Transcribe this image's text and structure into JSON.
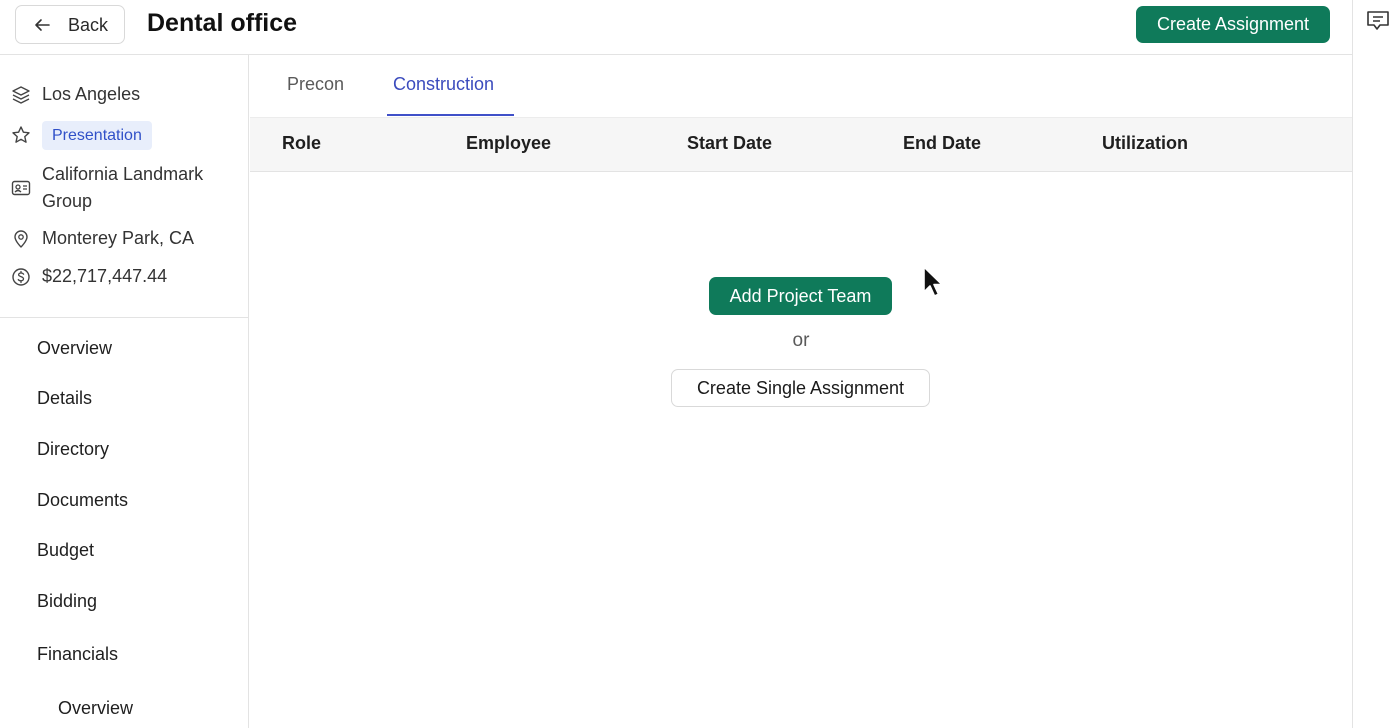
{
  "header": {
    "back_label": "Back",
    "title": "Dental office",
    "create_assignment_label": "Create Assignment"
  },
  "sidebar": {
    "meta": {
      "region": "Los Angeles",
      "stage_badge": "Presentation",
      "client": "California Landmark Group",
      "location": "Monterey Park, CA",
      "value": "$22,717,447.44"
    },
    "nav": [
      {
        "label": "Overview"
      },
      {
        "label": "Details"
      },
      {
        "label": "Directory"
      },
      {
        "label": "Documents"
      },
      {
        "label": "Budget"
      },
      {
        "label": "Bidding"
      },
      {
        "label": "Financials"
      },
      {
        "label": "Overview"
      }
    ]
  },
  "tabs": [
    {
      "label": "Precon",
      "active": false
    },
    {
      "label": "Construction",
      "active": true
    }
  ],
  "table": {
    "columns": [
      "Role",
      "Employee",
      "Start Date",
      "End Date",
      "Utilization"
    ]
  },
  "empty_state": {
    "add_team_label": "Add Project Team",
    "or_label": "or",
    "single_assignment_label": "Create Single Assignment"
  },
  "colors": {
    "primary_green": "#0f7a5a",
    "active_tab": "#3b4bbd",
    "badge_bg": "#e8eefb"
  },
  "icons": {
    "back": "arrow-left-icon",
    "comment": "comment-icon",
    "region": "layers-icon",
    "stage": "star-icon",
    "client": "id-card-icon",
    "location": "map-pin-icon",
    "value": "dollar-circle-icon"
  }
}
